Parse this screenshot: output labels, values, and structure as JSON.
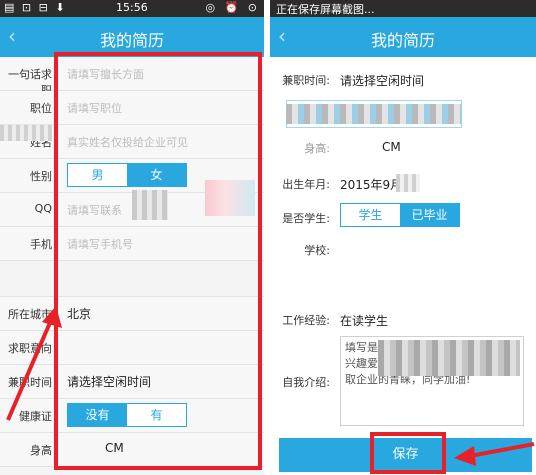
{
  "left": {
    "status": {
      "icons": "▤ ⊡ ⊟ ⬇",
      "time": "15:56",
      "right_icons": "◎ ⏰ ⊙"
    },
    "title": "我的简历",
    "back": "‹",
    "rows": {
      "intro": {
        "label": "一句话求职",
        "placeholder": "请填写擅长方面"
      },
      "job": {
        "label": "职位",
        "placeholder": "请填写职位"
      },
      "name": {
        "label": "姓名",
        "placeholder": "真实姓名仅投给企业可见"
      },
      "gender": {
        "label": "性别",
        "opt1": "男",
        "opt2": "女"
      },
      "qq": {
        "label": "QQ",
        "placeholder": "请填写联系"
      },
      "phone": {
        "label": "手机",
        "placeholder": "请填写手机号"
      },
      "city": {
        "label": "所在城市",
        "value": "北京"
      },
      "intent": {
        "label": "求职意向"
      },
      "freetime": {
        "label": "兼职时间",
        "value": "请选择空闲时间"
      },
      "health": {
        "label": "健康证",
        "opt1": "没有",
        "opt2": "有"
      },
      "height": {
        "label": "身高",
        "value": "CM"
      }
    }
  },
  "right": {
    "status": {
      "text": "正在保存屏幕截图..."
    },
    "title": "我的简历",
    "back": "‹",
    "freetime": {
      "label": "兼职时间:",
      "value": "请选择空闲时间"
    },
    "height": {
      "label": "身高:",
      "value": "CM"
    },
    "birth": {
      "label": "出生年月:",
      "value": "2015年9月"
    },
    "student": {
      "label": "是否学生:",
      "opt1": "学生",
      "opt2": "已毕业"
    },
    "school": {
      "label": "学校:"
    },
    "work": {
      "label": "工作经验:",
      "value": "在读学生"
    },
    "intro": {
      "label": "自我介绍:",
      "line1": "填写是",
      "line2": "兴趣爱",
      "line3": "取企业的青睐，同学加油!"
    },
    "save": "保存"
  },
  "colors": {
    "accent": "#29a8e0",
    "annotation": "#e8202a"
  }
}
